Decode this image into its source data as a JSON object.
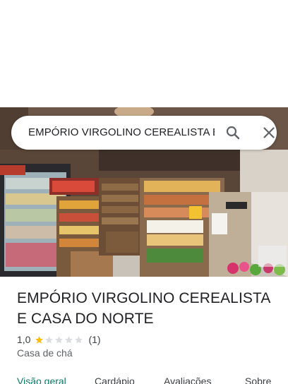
{
  "search": {
    "query": "EMPÓRIO VIRGOLINO CEREALISTA E CASA DO NORTE",
    "search_icon": "search-icon",
    "close_icon": "close-icon"
  },
  "place": {
    "title": "EMPÓRIO VIRGOLINO CEREALISTA E CASA DO NORTE",
    "rating": "1,0",
    "rating_value": 1,
    "rating_max": 5,
    "review_count": "(1)",
    "category": "Casa de chá"
  },
  "tabs": [
    {
      "label": "Visão geral",
      "active": true
    },
    {
      "label": "Cardápio",
      "active": false
    },
    {
      "label": "Avaliações",
      "active": false
    },
    {
      "label": "Sobre",
      "active": false
    }
  ],
  "colors": {
    "accent": "#0b7a66",
    "star_filled": "#fbbc04",
    "star_empty": "#dadce0"
  }
}
